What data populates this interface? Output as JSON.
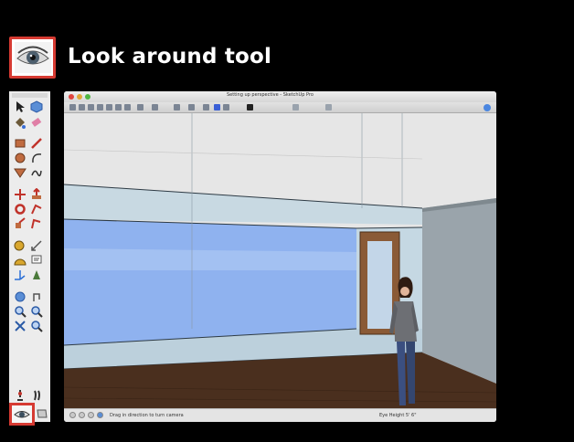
{
  "slide": {
    "title": "Look around tool",
    "header_icon": "eye-icon"
  },
  "window": {
    "title": "Setting up perspective - SketchUp Pro",
    "status_text": "Drag in direction to turn camera",
    "measurements_label": "Eye Height",
    "measurements_value": "5' 6\""
  },
  "palette": {
    "tools": [
      "select-icon",
      "component-icon",
      "paint-bucket-icon",
      "eraser-icon",
      "rectangle-icon",
      "line-icon",
      "circle-icon",
      "arc-icon",
      "polygon-icon",
      "freehand-icon",
      "move-icon",
      "push-pull-icon",
      "rotate-icon",
      "follow-me-icon",
      "scale-icon",
      "offset-icon",
      "tape-measure-icon",
      "dimension-icon",
      "protractor-icon",
      "text-icon",
      "axes-icon",
      "3d-text-icon",
      "orbit-icon",
      "pan-icon",
      "zoom-icon",
      "zoom-window-icon",
      "zoom-extents-icon",
      "previous-view-icon",
      "position-camera-icon",
      "walk-icon",
      "look-around-icon",
      "section-plane-icon"
    ],
    "highlighted_tool": "look-around-icon"
  },
  "colors": {
    "highlight": "#d63a32",
    "sky": "#e8e8e8",
    "wall": "#b7cfd9",
    "glass": "#8fb2ef",
    "floor": "#4a2f1e",
    "door_frame": "#8a5a36"
  }
}
